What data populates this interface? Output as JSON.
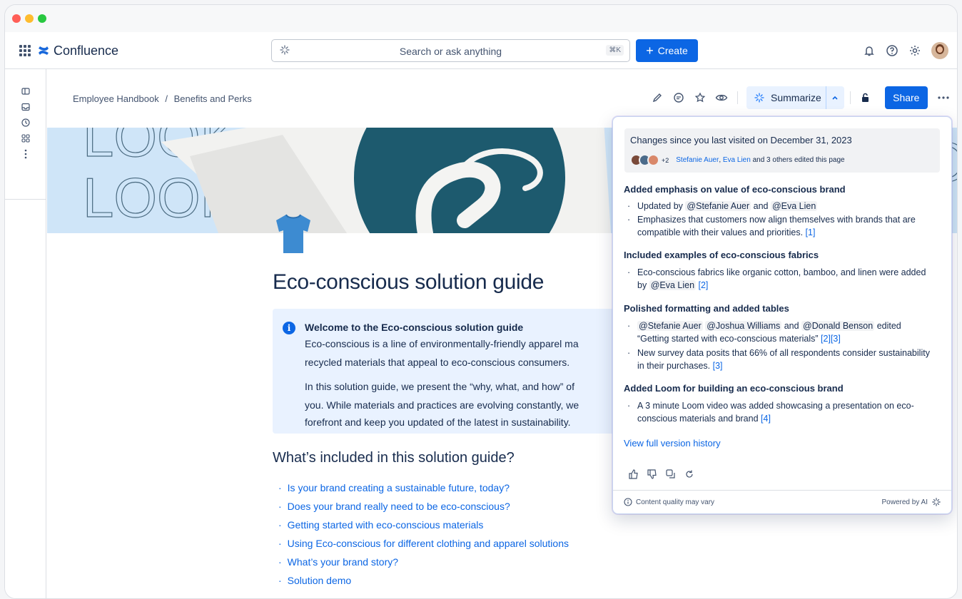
{
  "app": {
    "name": "Confluence"
  },
  "search": {
    "placeholder": "Search or ask anything",
    "shortcut": "⌘K"
  },
  "create_label": "Create",
  "breadcrumb": {
    "parent": "Employee Handbook",
    "separator": "/",
    "current": "Benefits and Perks"
  },
  "toolbar": {
    "summarize_label": "Summarize",
    "share_label": "Share"
  },
  "page": {
    "title": "Eco-conscious solution guide",
    "info": {
      "title": "Welcome to the Eco-conscious solution guide",
      "lines": [
        "Eco-conscious is a line of environmentally-friendly apparel ma",
        "recycled materials that appeal to eco-conscious consumers.",
        "In this solution guide, we present the “why, what, and how” of",
        "you. While materials and practices are evolving constantly, we",
        "forefront and keep you updated of the latest in sustainability."
      ]
    },
    "section_heading": "What’s included in this solution guide?",
    "toc": [
      "Is your brand creating a sustainable future, today?",
      "Does your brand really need to be eco-conscious?",
      "Getting started with eco-conscious materials",
      "Using Eco-conscious for different clothing and apparel solutions",
      "What’s your brand story?",
      "Solution demo"
    ]
  },
  "summary": {
    "changes_heading": "Changes since you last visited on December 31, 2023",
    "avatar_more": "+2",
    "editor1": "Stefanie Auer",
    "editor_comma": ",",
    "editor2": "Eva Lien",
    "editors_suffix": "and 3 others edited this page",
    "sections": [
      {
        "title": "Added emphasis on value of eco-conscious brand",
        "b1_pre": "Updated by ",
        "b1_m1": "@Stefanie Auer",
        "b1_mid": " and ",
        "b1_m2": "@Eva Lien",
        "b2_text": "Emphasizes that customers now align themselves with brands that are compatible with their values and priorities. ",
        "b2_ref": "[1]"
      },
      {
        "title": "Included examples of eco-conscious fabrics",
        "b1_text": "Eco-conscious fabrics like organic cotton, bamboo, and linen were added by ",
        "b1_m": "@Eva Lien",
        "b1_ref": " [2]"
      },
      {
        "title": "Polished formatting and added tables",
        "b1_m1": "@Stefanie Auer",
        "b1_m2": "@Joshua Williams",
        "b1_and": " and ",
        "b1_m3": "@Donald Benson",
        "b1_text": " edited “Getting started with eco-conscious materials” ",
        "b1_ref": "[2][3]",
        "b2_text": "New survey data posits that 66% of all respondents consider sustainability in their purchases. ",
        "b2_ref": "[3]"
      },
      {
        "title": "Added Loom for building an eco-conscious brand",
        "b1_text": "A 3 minute Loom video was added showcasing a presentation on eco-conscious materials and brand ",
        "b1_ref": "[4]"
      }
    ],
    "view_history": "View full version history",
    "footer_left": "Content quality may vary",
    "footer_right": "Powered by AI"
  },
  "banner_text": "LOOK",
  "colors": {
    "primary": "#0c66e4",
    "banner_bg": "#cfe5f8",
    "circle": "#1d5a6e",
    "shirt": "#3d8bd1"
  }
}
